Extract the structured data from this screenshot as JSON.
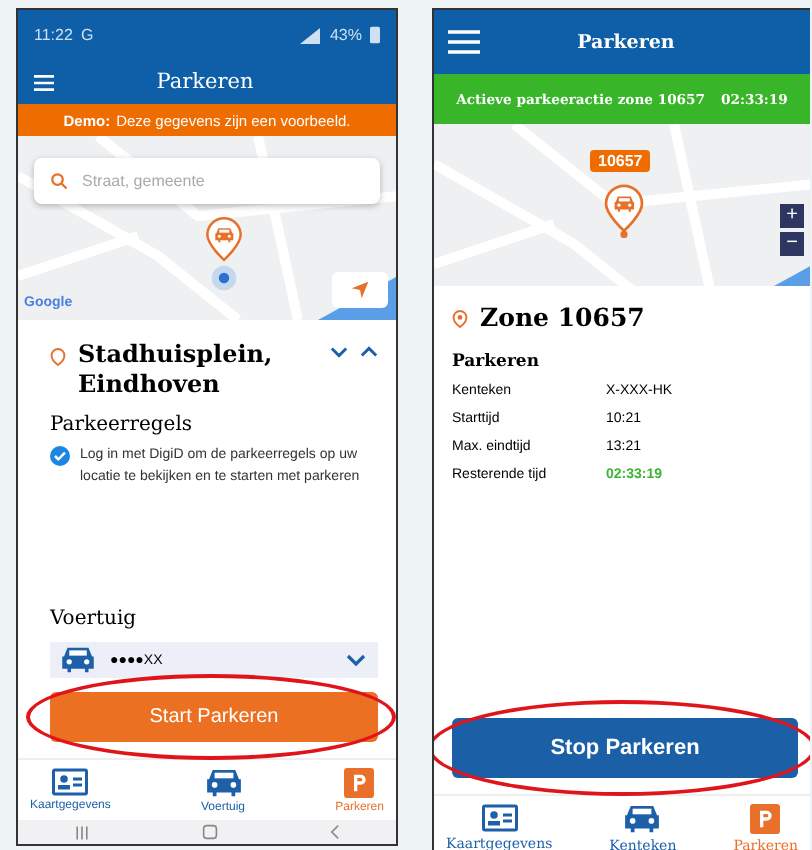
{
  "screens": [
    {
      "kind": "start",
      "status_bar": {
        "time": "11:22",
        "carrier": "G",
        "battery": "43%"
      },
      "header": {
        "title": "Parkeren"
      },
      "banner": {
        "label": "Demo:",
        "text": "Deze gegevens zijn een voorbeeld."
      },
      "map": {
        "search_placeholder": "Straat, gemeente",
        "attribution": "Google"
      },
      "location": {
        "title": "Stadhuisplein, Eindhoven"
      },
      "rules": {
        "heading": "Parkeerregels",
        "text": "Log in met DigiD om de parkeerregels op uw locatie te bekijken en te starten met parkeren",
        "checked": true
      },
      "vehicle": {
        "label": "Voertuig",
        "plate": "●●●●XX"
      },
      "button": {
        "label": "Start Parkeren",
        "circled": true
      },
      "nav": [
        {
          "label": "Kaartgegevens",
          "kind": "card",
          "selected": false
        },
        {
          "label": "Voertuig",
          "kind": "car",
          "selected": false
        },
        {
          "label": "Parkeren",
          "kind": "parking",
          "selected": true
        }
      ]
    },
    {
      "kind": "active",
      "header": {
        "title": "Parkeren"
      },
      "banner": {
        "text": "Actieve parkeeractie zone 10657",
        "timer": "02:33:19"
      },
      "map": {
        "zone_badge": "10657",
        "zoom_in": "+",
        "zoom_out": "−"
      },
      "zone": {
        "title": "Zone 10657"
      },
      "section": {
        "heading": "Parkeren"
      },
      "rows": [
        {
          "label": "Kenteken",
          "value": "X-XXX-HK",
          "highlight": false
        },
        {
          "label": "Starttijd",
          "value": "10:21",
          "highlight": false
        },
        {
          "label": "Max. eindtijd",
          "value": "13:21",
          "highlight": false
        },
        {
          "label": "Resterende tijd",
          "value": "02:33:19",
          "highlight": true
        }
      ],
      "button": {
        "label": "Stop Parkeren",
        "circled": true
      },
      "nav": [
        {
          "label": "Kaartgegevens",
          "kind": "card",
          "selected": false
        },
        {
          "label": "Kenteken",
          "kind": "car",
          "selected": false
        },
        {
          "label": "Parkeren",
          "kind": "parking",
          "selected": true
        }
      ]
    }
  ]
}
